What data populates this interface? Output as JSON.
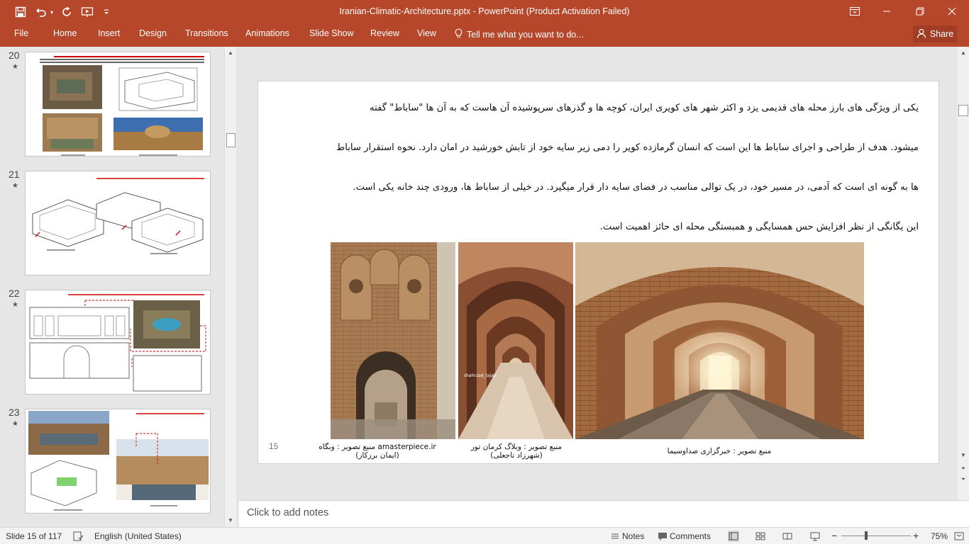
{
  "window": {
    "title": "Iranian-Climatic-Architecture.pptx - PowerPoint (Product Activation Failed)"
  },
  "quick_access": {
    "icons": [
      "save-icon",
      "undo-icon",
      "undo-dropdown-icon",
      "redo-icon",
      "present-from-start-icon",
      "customize-qat-icon"
    ]
  },
  "window_controls": [
    "ribbon-display-options-icon",
    "minimize-icon",
    "restore-icon",
    "close-icon"
  ],
  "ribbon": {
    "tabs": [
      "File",
      "Home",
      "Insert",
      "Design",
      "Transitions",
      "Animations",
      "Slide Show",
      "Review",
      "View"
    ],
    "tell_me": "Tell me what you want to do...",
    "share": "Share"
  },
  "thumbnails": [
    {
      "number": "20",
      "star": "★"
    },
    {
      "number": "21",
      "star": "★"
    },
    {
      "number": "22",
      "star": "★"
    },
    {
      "number": "23",
      "star": "★"
    }
  ],
  "slide": {
    "paragraph_lines": [
      "یکی از ویژگی های بارز محله های قدیمی یزد و اکثر شهر های کویری ایران، کوچه ها و گذرهای سرپوشیده آن هاست که به آن ها \"ساباط\" گفته",
      "میشود. هدف از طراحی و اجرای ساباط ها این است که انسان گرمازده کویر را دمی زیر سایه خود از تابش خورشید در امان دارد. نحوه استقرار ساباط",
      "ها به گونه ای است که آدمی، در مسیر خود، در یک توالی مناسب در فضای سایه دار قرار میگیرد. در خیلی از ساباط ها، ورودی چند خانه یکی است.",
      "این یگانگی از نظر افزایش حس همسایگی و همبستگی محله ای حائز اهمیت است."
    ],
    "photo_watermark": "shahrzad_tajali",
    "captions": [
      {
        "line1": "منبع تصویر : وبگاه amasterpiece.ir",
        "line2": "(ایمان برزکار)"
      },
      {
        "line1": "منبع تصویر : وبلاگ کرمان تور",
        "line2": "(شهرزاد تاجعلی)"
      },
      {
        "line1": "منبع تصویر : خبرگزاری صداوسیما",
        "line2": ""
      }
    ],
    "page_number": "15"
  },
  "notes_placeholder": "Click to add notes",
  "status": {
    "slide_info": "Slide 15 of 117",
    "language": "English (United States)",
    "notes": "Notes",
    "comments": "Comments",
    "zoom": "75%"
  },
  "colors": {
    "accent": "#b7472a",
    "share_bg": "#a03d24",
    "slide_bg": "#ffffff",
    "workspace": "#e6e6e6"
  }
}
